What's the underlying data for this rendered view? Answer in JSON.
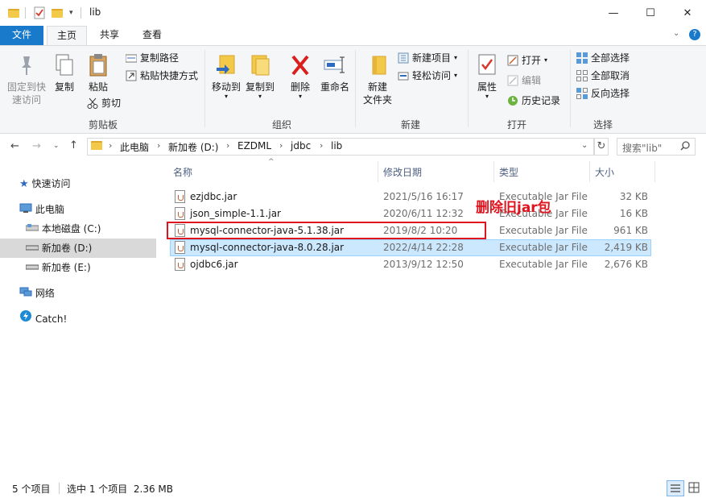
{
  "window": {
    "title": "lib",
    "minimize": "—",
    "maximize": "☐",
    "close": "✕"
  },
  "tabs": [
    "文件",
    "主页",
    "共享",
    "查看"
  ],
  "ribbon": {
    "clipboard": {
      "label": "剪贴板",
      "pin": "固定到快速访问",
      "pin1": "固定到快",
      "pin2": "速访问",
      "copy": "复制",
      "paste": "粘贴",
      "copy_path": "复制路径",
      "paste_shortcut": "粘贴快捷方式",
      "cut": "剪切"
    },
    "organize": {
      "label": "组织",
      "move_to": "移动到",
      "copy_to": "复制到",
      "delete": "删除",
      "rename": "重命名"
    },
    "new": {
      "label": "新建",
      "new_folder1": "新建",
      "new_folder2": "文件夹",
      "new_item": "新建项目",
      "easy_access": "轻松访问"
    },
    "open": {
      "label": "打开",
      "properties": "属性",
      "open": "打开",
      "edit": "编辑",
      "history": "历史记录"
    },
    "select": {
      "label": "选择",
      "select_all": "全部选择",
      "select_none": "全部取消",
      "invert": "反向选择"
    }
  },
  "address": {
    "crumbs": [
      "此电脑",
      "新加卷 (D:)",
      "EZDML",
      "jdbc",
      "lib"
    ],
    "search_placeholder": "搜索\"lib\""
  },
  "nav": {
    "quick_access": "快速访问",
    "this_pc": "此电脑",
    "c_drive": "本地磁盘 (C:)",
    "d_drive": "新加卷 (D:)",
    "e_drive": "新加卷 (E:)",
    "network": "网络",
    "catch": "Catch!"
  },
  "columns": {
    "name": "名称",
    "date": "修改日期",
    "type": "类型",
    "size": "大小"
  },
  "files": [
    {
      "name": "ezjdbc.jar",
      "date": "2021/5/16 16:17",
      "type": "Executable Jar File",
      "size": "32 KB"
    },
    {
      "name": "json_simple-1.1.jar",
      "date": "2020/6/11 12:32",
      "type": "Executable Jar File",
      "size": "16 KB"
    },
    {
      "name": "mysql-connector-java-5.1.38.jar",
      "date": "2019/8/2 10:20",
      "type": "Executable Jar File",
      "size": "961 KB"
    },
    {
      "name": "mysql-connector-java-8.0.28.jar",
      "date": "2022/4/14 22:28",
      "type": "Executable Jar File",
      "size": "2,419 KB"
    },
    {
      "name": "ojdbc6.jar",
      "date": "2013/9/12 12:50",
      "type": "Executable Jar File",
      "size": "2,676 KB"
    }
  ],
  "annotation": "删除旧jar包",
  "status": {
    "count": "5 个项目",
    "selected": "选中 1 个项目  2.36 MB"
  },
  "colors": {
    "accent": "#1979ca",
    "selection": "#cce8ff",
    "annotation": "#e0141e"
  }
}
